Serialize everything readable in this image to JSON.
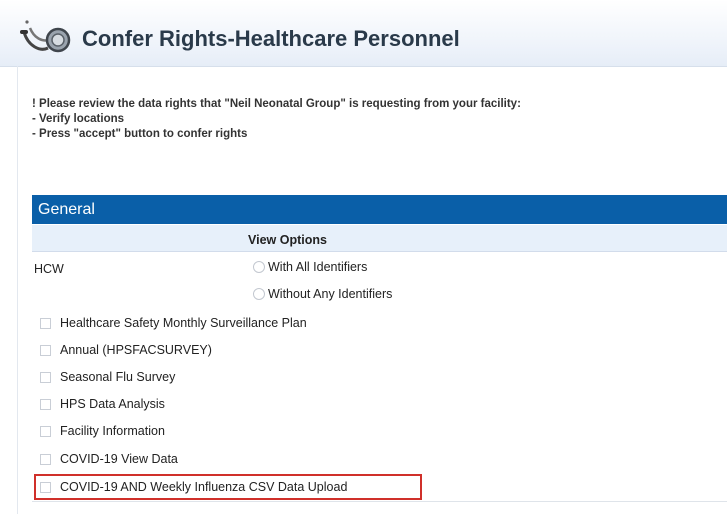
{
  "header": {
    "title": "Confer Rights-Healthcare Personnel",
    "logo_icon": "stethoscope-icon"
  },
  "instructions": {
    "line1": "! Please review the data rights that \"Neil Neonatal Group\" is requesting from your facility:",
    "line2": " - Verify locations",
    "line3": " - Press \"accept\" button to confer rights"
  },
  "general": {
    "title": "General",
    "view_options_label": "View Options",
    "row_label": "HCW",
    "radio_options": [
      "With All Identifiers",
      "Without Any Identifiers"
    ],
    "checkbox_items": [
      "Healthcare Safety Monthly Surveillance Plan",
      "Annual (HPSFACSURVEY)",
      "Seasonal Flu Survey",
      "HPS Data Analysis",
      "Facility Information",
      "COVID-19 View Data",
      "COVID-19 AND Weekly Influenza CSV Data Upload"
    ]
  },
  "colors": {
    "section_bar": "#0a5fa8",
    "highlight_border": "#d0302a"
  }
}
